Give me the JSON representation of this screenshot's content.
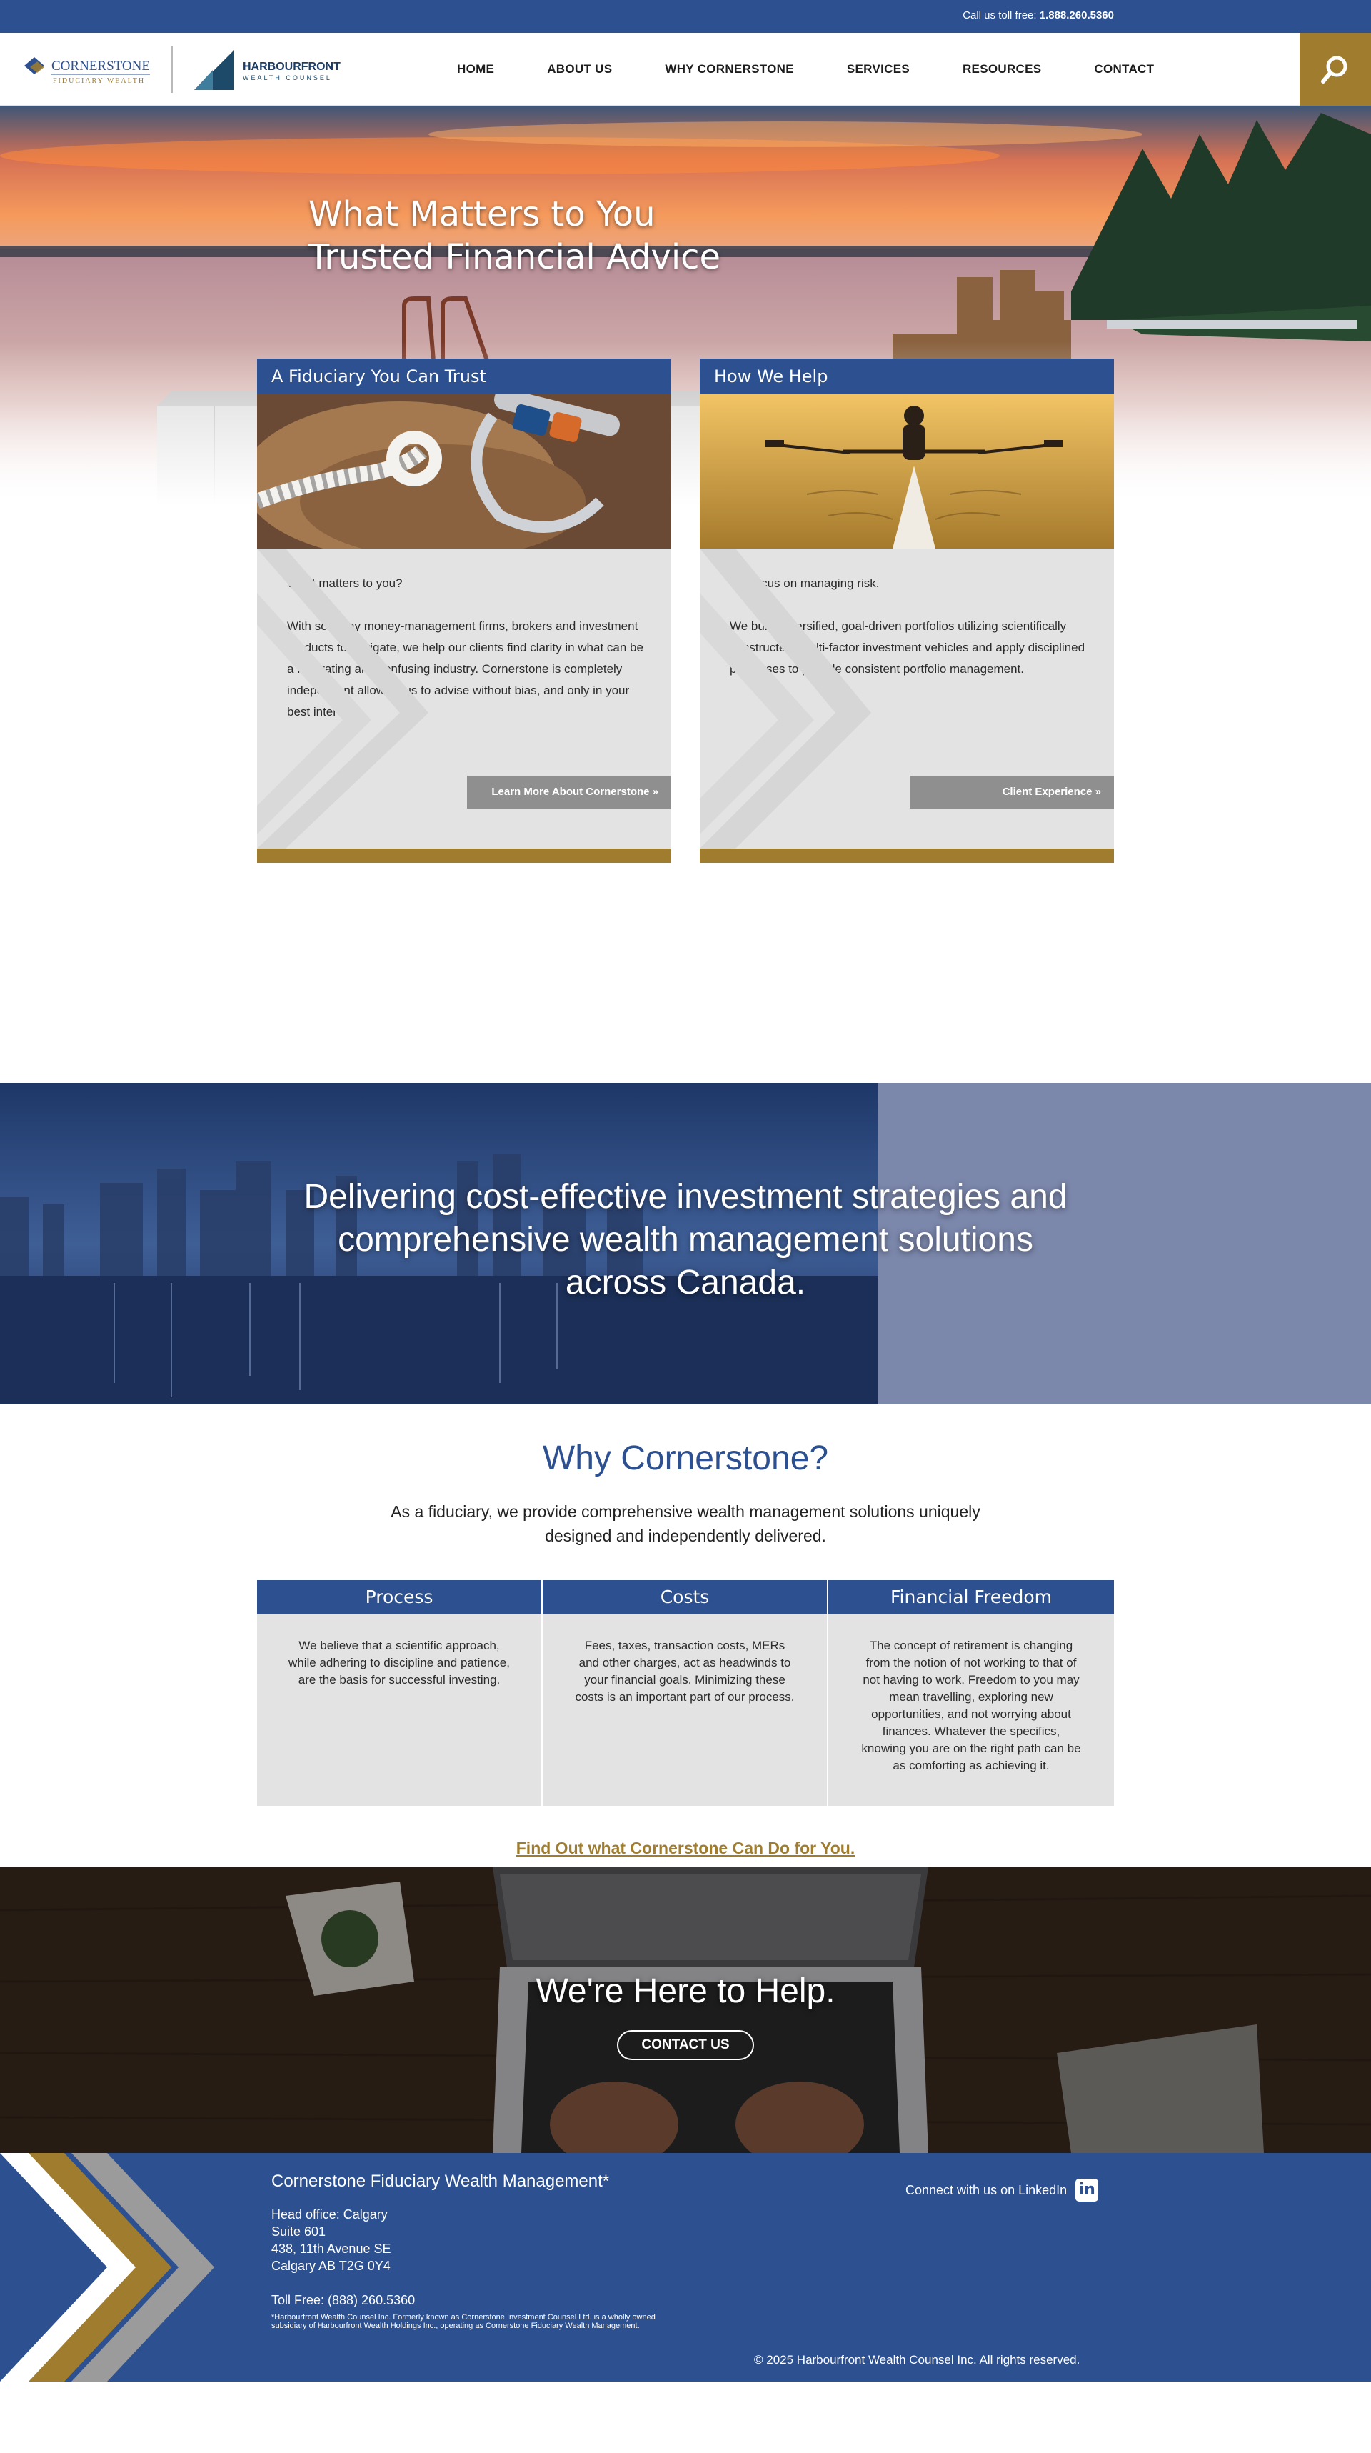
{
  "topbar": {
    "call_prefix": "Call us toll free: ",
    "phone": "1.888.260.5360"
  },
  "logos": {
    "cornerstone_name": "CORNERSTONE",
    "cornerstone_sub": "FIDUCIARY WEALTH",
    "harbourfront_name": "HARBOURFRONT",
    "harbourfront_sub": "WEALTH COUNSEL"
  },
  "nav": {
    "items": [
      {
        "label": "HOME"
      },
      {
        "label": "ABOUT US"
      },
      {
        "label": "WHY CORNERSTONE"
      },
      {
        "label": "SERVICES"
      },
      {
        "label": "RESOURCES"
      },
      {
        "label": "CONTACT"
      }
    ],
    "search_icon": "search-icon"
  },
  "hero": {
    "line1": "What Matters to You",
    "line2": "Trusted Financial Advice"
  },
  "cards": [
    {
      "title": "A Fiduciary You Can Trust",
      "p1": "What matters to you?",
      "p2": "With so many money-management firms, brokers and investment products to navigate, we help our clients find clarity in what can be a frustrating and confusing industry. Cornerstone is completely independent allowing us to advise without bias, and only in your best interests.",
      "button": "Learn More About Cornerstone  »"
    },
    {
      "title": "How We Help",
      "p1": "We focus on managing risk.",
      "p2": "We build diversified, goal-driven portfolios utilizing scientifically constructed, multi-factor investment vehicles and apply disciplined processes to provide consistent portfolio management.",
      "button": "Client Experience  »"
    }
  ],
  "banner": {
    "text": "Delivering cost-effective investment strategies and comprehensive wealth management solutions across Canada."
  },
  "why": {
    "title": "Why Cornerstone?",
    "lead": "As a fiduciary, we provide comprehensive wealth management solutions uniquely designed and independently delivered.",
    "columns": [
      {
        "title": "Process",
        "body": "We believe that a scientific approach, while adhering to discipline and patience, are the basis for successful investing."
      },
      {
        "title": "Costs",
        "body": "Fees, taxes, transaction costs, MERs and other charges, act as headwinds to your financial goals. Minimizing these costs is an important part of our process."
      },
      {
        "title": "Financial Freedom",
        "body": "The concept of retirement is changing from the notion of not working to that of not having to work. Freedom to you may mean travelling, exploring new opportunities, and not worrying about finances. Whatever the specifics, knowing you are on the right path can be as comforting as achieving it."
      }
    ],
    "cta": "Find Out what Cornerstone Can Do for You."
  },
  "help": {
    "title": "We're Here to Help.",
    "button": "CONTACT US"
  },
  "footer": {
    "company": "Cornerstone Fiduciary Wealth Management*",
    "address": [
      "Head office: Calgary",
      "Suite 601",
      "438, 11th Avenue SE",
      "Calgary AB T2G 0Y4"
    ],
    "toll": "Toll Free:  (888) 260.5360",
    "note": "*Harbourfront Wealth Counsel Inc. Formerly known as Cornerstone Investment Counsel Ltd. is a wholly owned subsidiary of Harbourfront Wealth Holdings Inc., operating as Cornerstone Fiduciary Wealth Management.",
    "linkedin_text": "Connect with us on LinkedIn",
    "linkedin_icon": "linkedin-icon",
    "copyright": "© 2025 Harbourfront Wealth Counsel Inc. All rights reserved."
  },
  "colors": {
    "brand_blue": "#2c5090",
    "gold": "#a07d2e",
    "grey_card": "#e3e3e3",
    "button_grey": "#8f8f8f"
  }
}
